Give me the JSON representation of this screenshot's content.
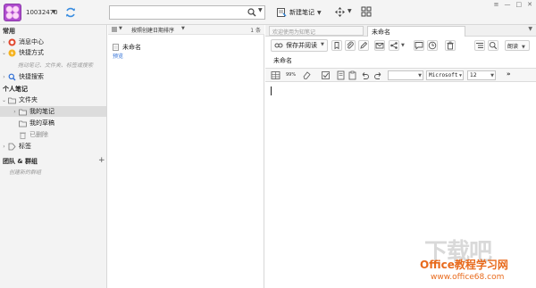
{
  "header": {
    "account": "10032470",
    "search_placeholder": "",
    "new_note_label": "新建笔记"
  },
  "sidebar": {
    "section_common": "常用",
    "message_center": "消息中心",
    "shortcuts": "快捷方式",
    "shortcuts_hint": "拖动笔记、文件夹、标签或搜索",
    "quick_search": "快捷搜索",
    "section_personal": "个人笔记",
    "folders": "文件夹",
    "my_notes": "我的笔记",
    "my_drafts": "我的草稿",
    "deleted": "已删除",
    "tags": "标签",
    "section_team": "团队 & 群组",
    "team_hint": "创建新的群组"
  },
  "list": {
    "sort_label": "按照创建日期排序",
    "count": "1 条",
    "note_title": "未命名",
    "note_preview": "预览"
  },
  "editor": {
    "tab_placeholder": "欢迎使用为知笔记",
    "tab_title": "未命名",
    "save_read_label": "保存并阅读",
    "lang_label": "朗读",
    "title_value": "未命名",
    "font_name": "Microsoft",
    "font_size": "12",
    "fmt_percent": "99%",
    "more": "»"
  },
  "watermark": {
    "logo": "下载吧",
    "line1": "Office教程学习网",
    "line2": "www.office68.com"
  },
  "colors": {
    "accent": "#2f6fd6",
    "watermark": "#e86a1c"
  }
}
